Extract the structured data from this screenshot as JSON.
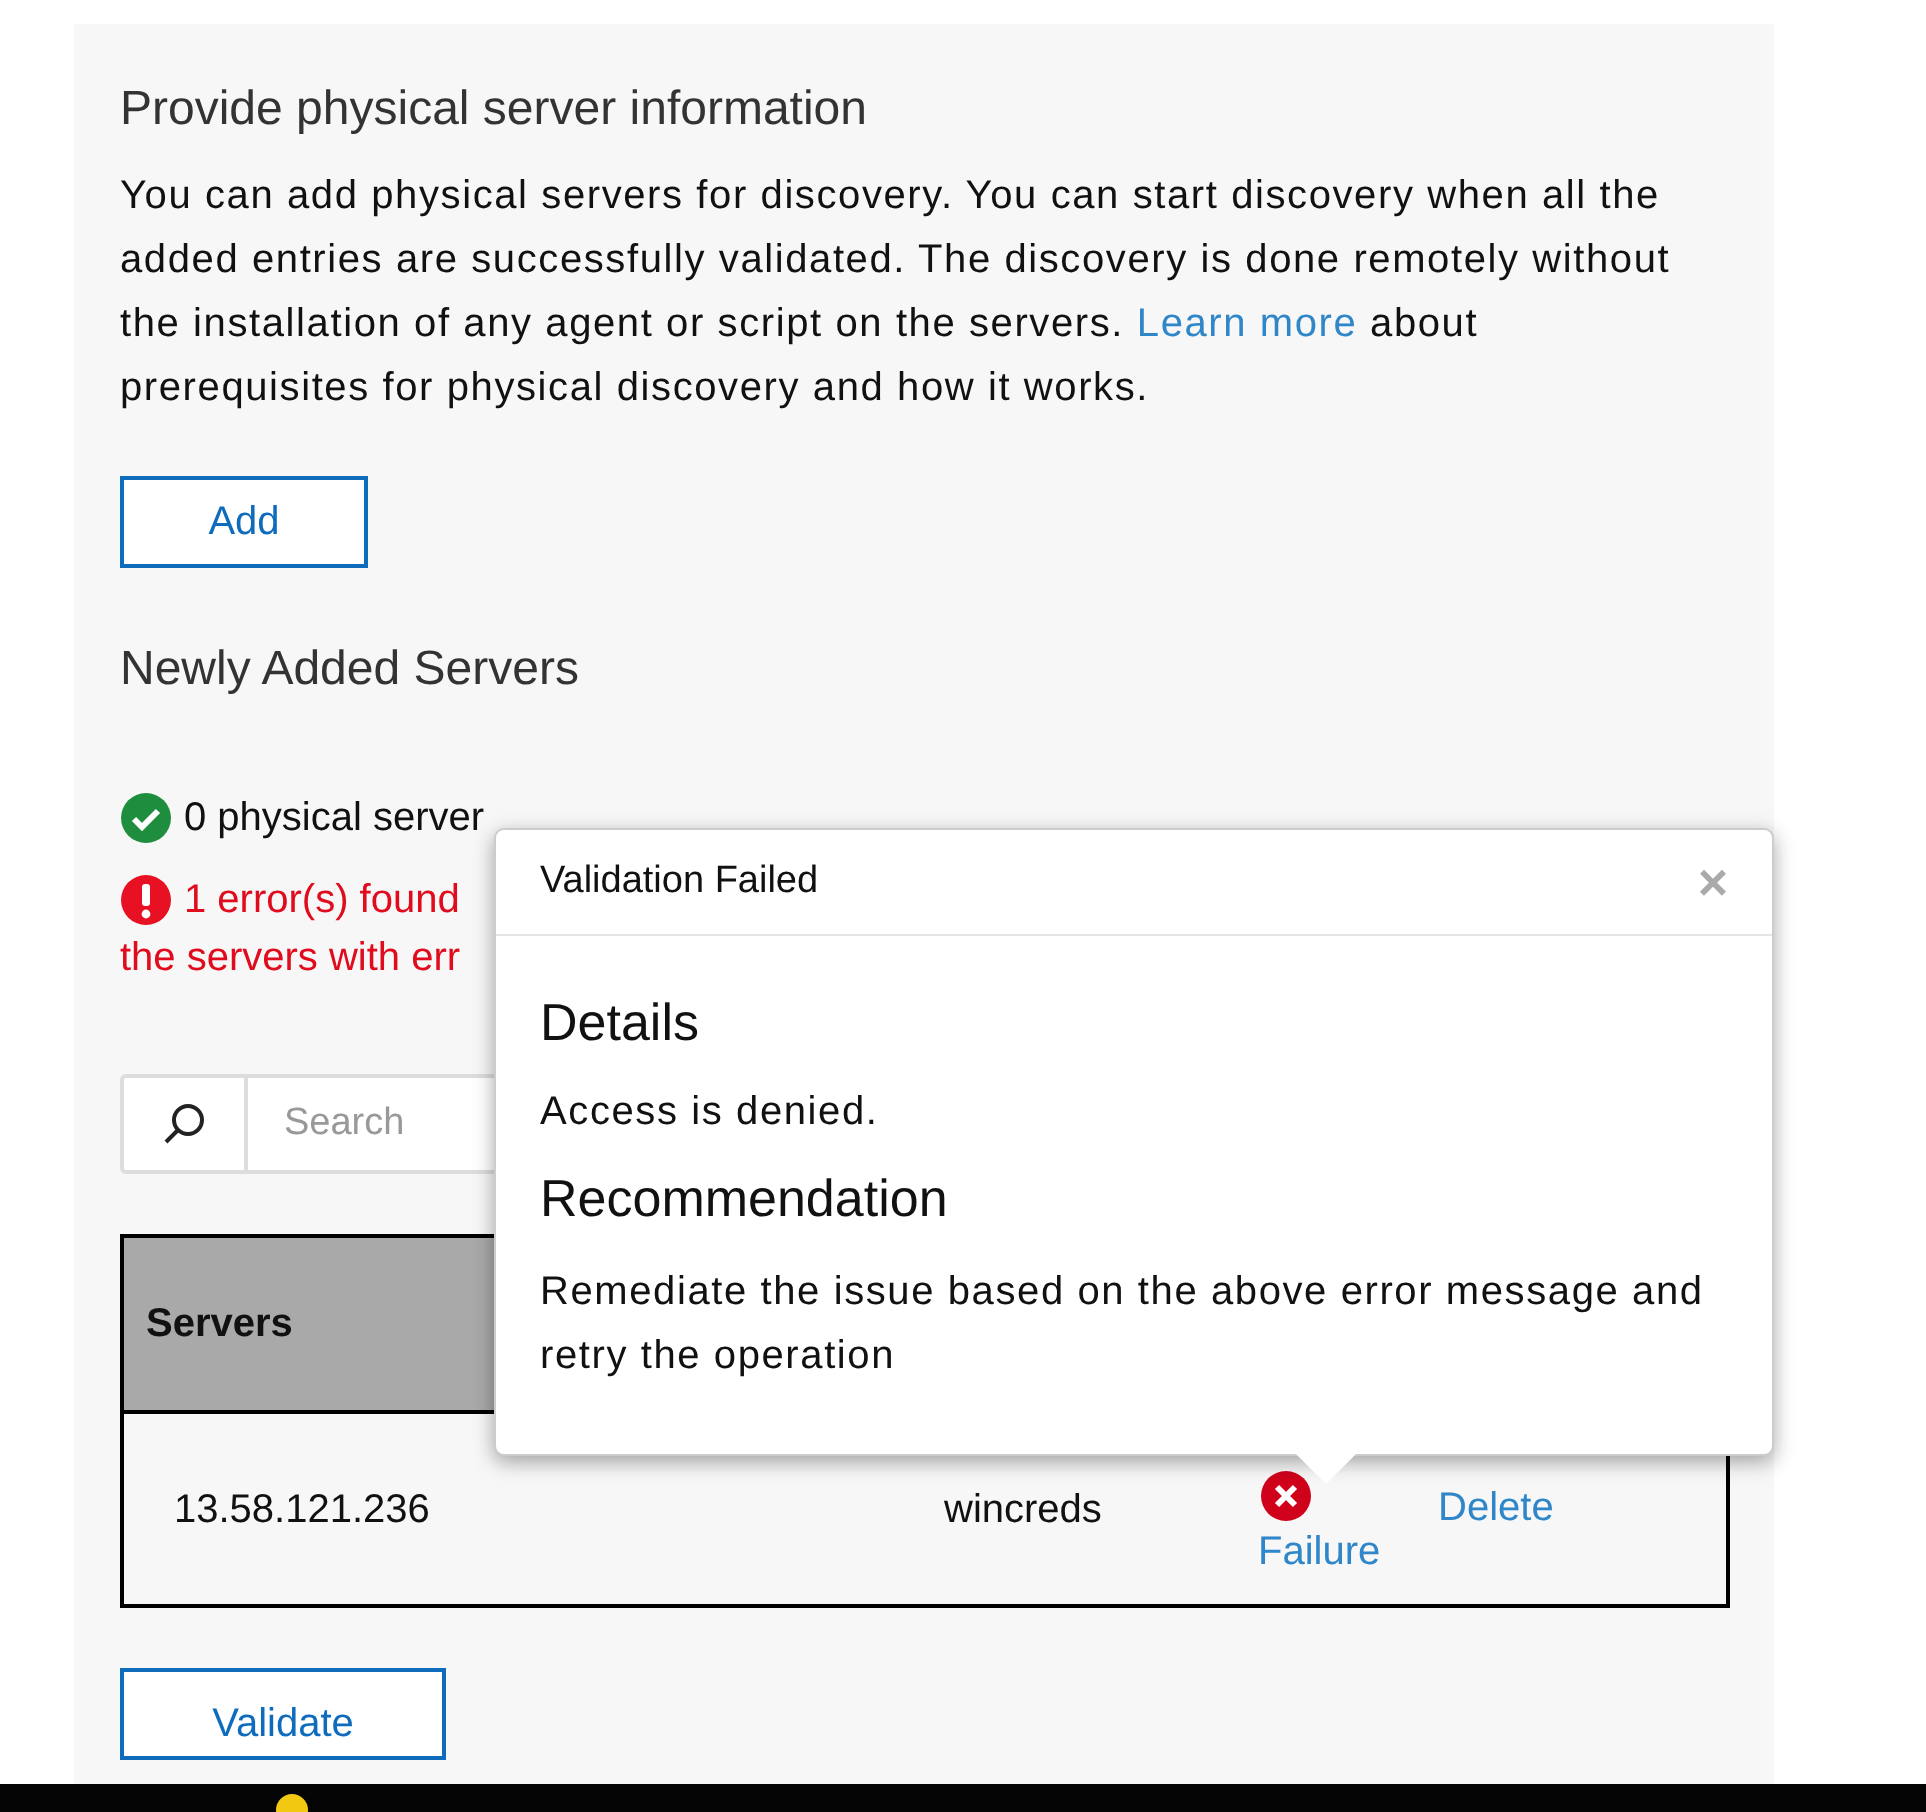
{
  "section": {
    "title": "Provide physical server information",
    "description_before": "You can add physical servers for discovery. You can start discovery when all the added entries are successfully validated. The discovery is done remotely without the installation of any agent or script on the servers. ",
    "link": "Learn more",
    "description_after": " about prerequisites for physical discovery and how it works."
  },
  "add_button": "Add",
  "servers_heading": "Newly Added Servers",
  "messages": [
    {
      "kind": "success",
      "lines": [
        "0 physical server"
      ]
    },
    {
      "kind": "error",
      "lines": [
        "1 error(s) found",
        "the servers with err"
      ]
    }
  ],
  "search": {
    "placeholder": "Search"
  },
  "table": {
    "columns": [
      "Servers"
    ],
    "rows": [
      {
        "server": "13.58.121.236",
        "credential": "wincreds",
        "status": {
          "kind": "failure",
          "label": "Failure"
        },
        "action": "Delete"
      }
    ]
  },
  "validate_button": "Validate",
  "popup": {
    "title": "Validation Failed",
    "close": "×",
    "sections": [
      {
        "heading": "Details",
        "text": "Access is denied."
      },
      {
        "heading": "Recommendation",
        "text": "Remediate the issue based on the above error message and retry the operation"
      }
    ]
  }
}
